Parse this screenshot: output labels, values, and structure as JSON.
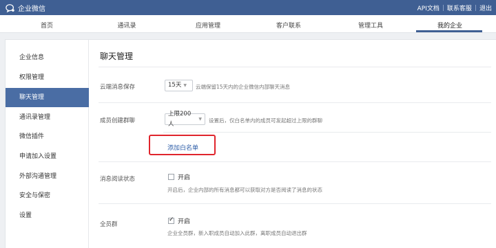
{
  "topbar": {
    "brand": "企业微信",
    "links": [
      "API文档",
      "联系客服",
      "退出"
    ]
  },
  "nav": {
    "tabs": [
      "首页",
      "通讯录",
      "应用管理",
      "客户联系",
      "管理工具",
      "我的企业"
    ],
    "active": "我的企业"
  },
  "sidebar": {
    "items": [
      "企业信息",
      "权限管理",
      "聊天管理",
      "通讯录管理",
      "微信插件",
      "申请加入设置",
      "外部沟通管理",
      "安全与保密",
      "设置"
    ],
    "active": "聊天管理"
  },
  "main": {
    "title": "聊天管理",
    "cloud": {
      "label": "云端消息保存",
      "value": "15天",
      "hint": "云端保留15天内的企业微信内部聊天消息"
    },
    "group": {
      "label": "成员创建群聊",
      "value": "上限200人",
      "hint": "设置后，仅白名单内的成员可发起超过上限的群聊",
      "whitelist_link": "添加白名单"
    },
    "read": {
      "label": "消息阅读状态",
      "checkbox_label": "开启",
      "checked": false,
      "desc": "开启后，企业内部的所有消息都可以获取对方是否阅读了消息的状态"
    },
    "all": {
      "label": "全员群",
      "checkbox_label": "开启",
      "checked": true,
      "desc": "企业全员群，新入职成员自动加入此群，离职成员自动退出群"
    }
  }
}
